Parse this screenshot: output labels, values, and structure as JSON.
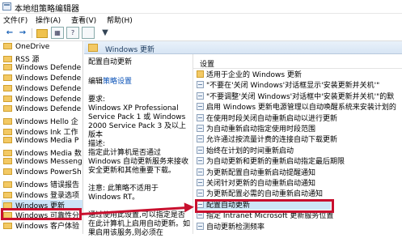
{
  "window": {
    "title": "本地组策略编辑器"
  },
  "menu": {
    "items": [
      "文件(F)",
      "操作(A)",
      "查看(V)",
      "帮助(H)"
    ]
  },
  "toolbar": {
    "back": "←",
    "forward": "→",
    "props": "▦",
    "help": "?",
    "filter": "▼"
  },
  "tree": {
    "items": [
      "OneDrive",
      "RSS 源",
      "Windows Defende",
      "Windows Defende",
      "Windows Defende",
      "Windows Defende",
      "Windows Defende",
      "Windows Hello 企",
      "Windows Ink 工作",
      "Windows Media P",
      "Windows Media 数",
      "Windows Messeng",
      "Windows PowerSh",
      "Windows 错误报告",
      "Windows 登录选项",
      "Windows 更新",
      "Windows 可靠性分",
      "Windows 客户体验"
    ],
    "selected_index": 15
  },
  "header": {
    "title": "Windows 更新"
  },
  "description": {
    "title": "配置自动更新",
    "edit_link_prefix": "编辑",
    "edit_link": "策略设置",
    "requirements_label": "要求:",
    "requirements_text": "Windows XP Professional Service Pack 1 或 Windows 2000 Service Pack 3 及以上版本",
    "desc_label": "描述:",
    "desc_text": "指定此计算机是否通过 Windows 自动更新服务来接收安全更新和其他重要下载。",
    "note_text": "注意: 此策略不适用于 Windows RT。",
    "tail_text": "通过使用此设置,可以指定是否在此计算机上启用自动更新。如果启用该服务,则必须在"
  },
  "settings": {
    "column_header": "设置",
    "rows": [
      {
        "label": "适用于企业的 Windows 更新",
        "folder": true
      },
      {
        "label": "\"不要在'关闭 Windows'对话框显示'安装更新并关机'\"",
        "folder": false
      },
      {
        "label": "\"不要调整'关闭 Windows'对话框中'安装更新并关机'\"的默",
        "folder": false
      },
      {
        "label": "启用 Windows 更新电源管理以自动唤醒系统来安装计划的",
        "folder": false
      },
      {
        "label": "在使用时段关闭自动重新启动以进行更新",
        "folder": false
      },
      {
        "label": "为自动重新启动指定使用时段范围",
        "folder": false
      },
      {
        "label": "允许通过按流量计费的连接自动下载更新",
        "folder": false
      },
      {
        "label": "始终在计划的时间重新启动",
        "folder": false
      },
      {
        "label": "为自动更新和更新的重新启动指定最后期限",
        "folder": false
      },
      {
        "label": "为更新配置自动重新启动提醒通知",
        "folder": false
      },
      {
        "label": "关闭针对更新的自动重新启动通知",
        "folder": false
      },
      {
        "label": "为更新配置必需的自动重新启动通知",
        "folder": false
      },
      {
        "label": "配置自动更新",
        "folder": false
      },
      {
        "label": "指定 Intranet Microsoft 更新服务位置",
        "folder": false
      },
      {
        "label": "自动更新检测频率",
        "folder": false
      }
    ],
    "selected_index": 12
  }
}
